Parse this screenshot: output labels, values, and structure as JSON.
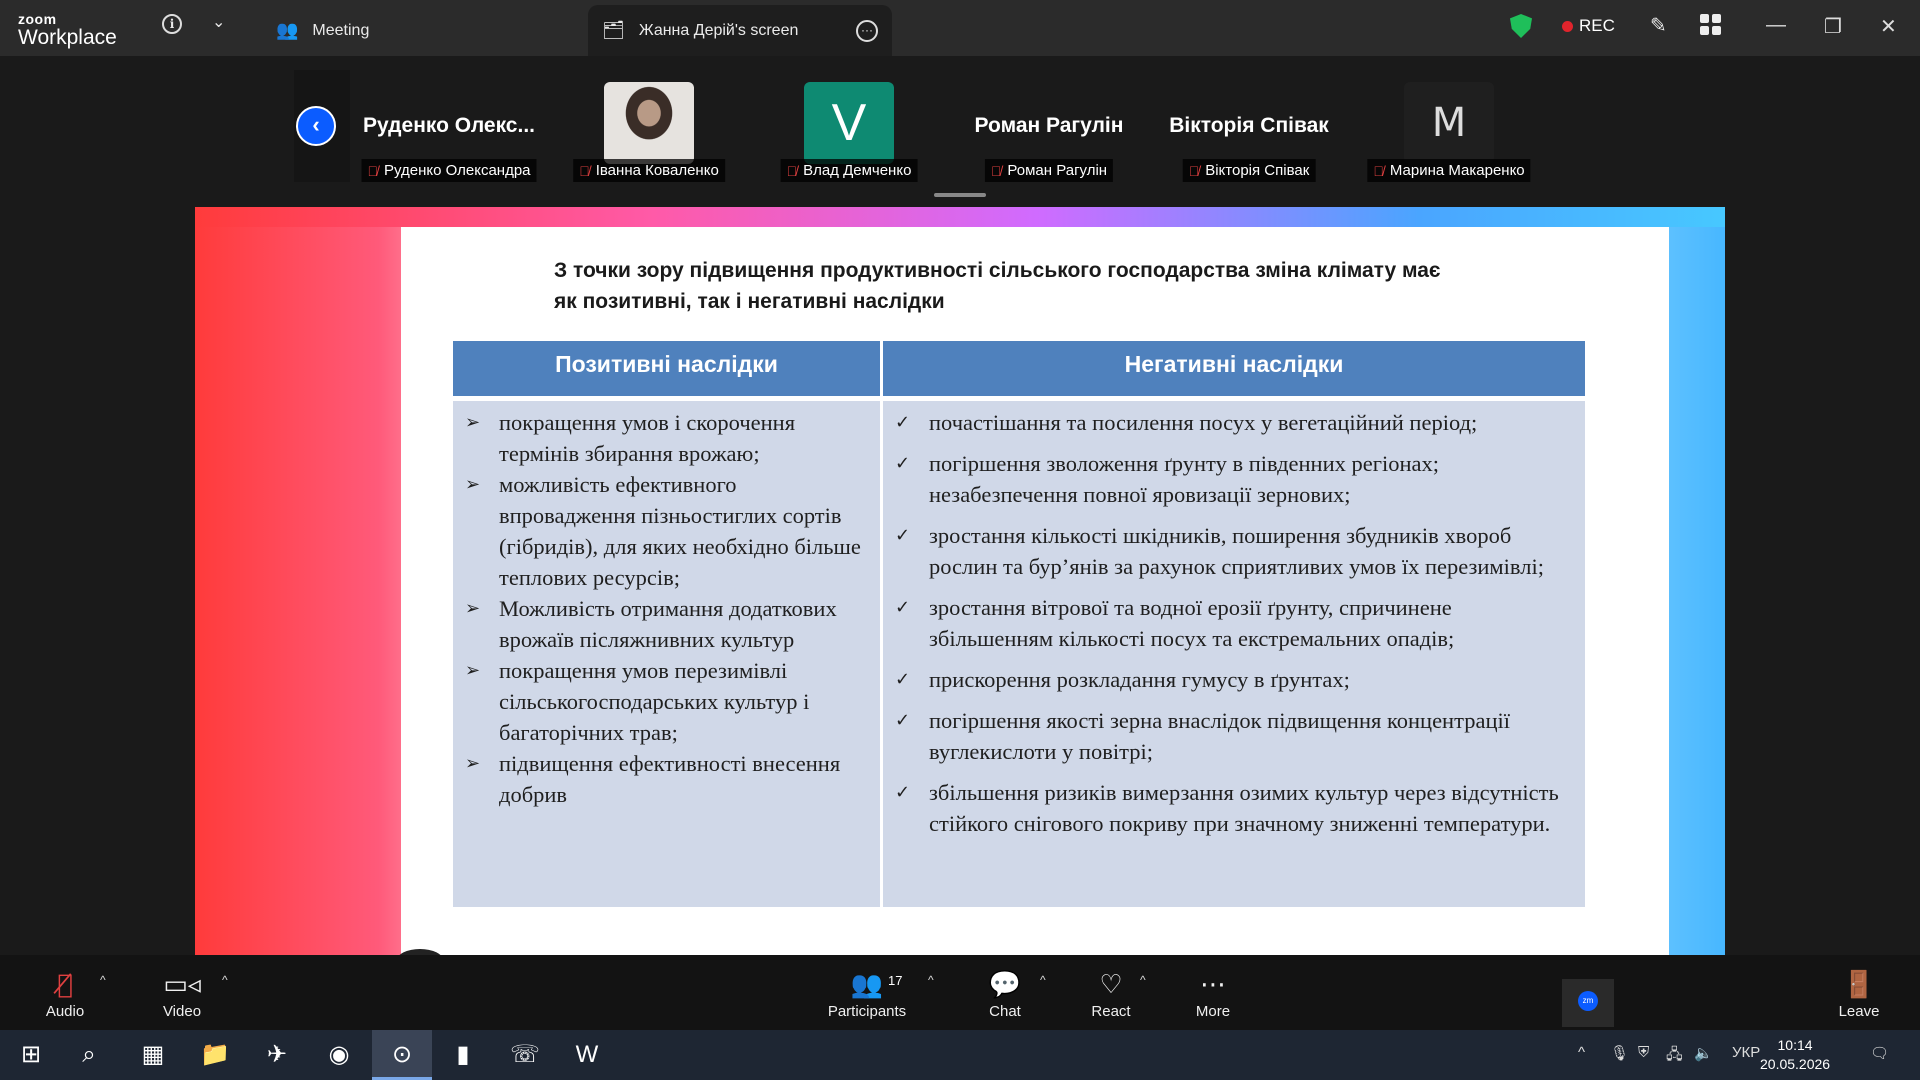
{
  "app": {
    "logo_small": "zoom",
    "logo_big": "Workplace"
  },
  "tabs": [
    {
      "label": "Meeting",
      "icon": "meeting-icon"
    },
    {
      "label": "Жанна Дерій's screen",
      "icon": "share-screen-icon"
    }
  ],
  "status": {
    "rec_label": "REC",
    "rec_color": "#e0242c",
    "shield_color": "#1fbf5a"
  },
  "participants": [
    {
      "display": "Руденко  Олекс...",
      "name": "Руденко Олександра",
      "avatar": "name"
    },
    {
      "display": "",
      "name": "Іванна Коваленко",
      "avatar": "photo"
    },
    {
      "display": "V",
      "name": "Влад Демченко",
      "avatar": "letter"
    },
    {
      "display": "Роман Рагулін",
      "name": "Роман Рагулін",
      "avatar": "name"
    },
    {
      "display": "Вікторія Співак",
      "name": "Вікторія Співак",
      "avatar": "name"
    },
    {
      "display": "M",
      "name": "Марина Макаренко",
      "avatar": "logo"
    }
  ],
  "slide": {
    "title_line1": "З точки зору підвищення продуктивності сільського господарства зміна клімату має",
    "title_line2": "як позитивні, так і негативні наслідки",
    "col1_header": "Позитивні наслідки",
    "col2_header": "Негативні наслідки",
    "positive": [
      "покращення умов і скорочення термінів збирання врожаю;",
      "можливість ефективного впровадження пізньостиглих сортів (гібридів), для яких необхідно більше теплових ресурсів;",
      "Можливість отримання додаткових врожаїв післяжнивних культур",
      "покращення умов перезимівлі сільськогосподарських культур і багаторічних трав;",
      " підвищення ефективності внесення добрив"
    ],
    "negative": [
      "почастішання та посилення посух у вегетаційний період;",
      "погіршення зволоження ґрунту в південних регіонах; незабезпечення повної яровизації зернових;",
      " зростання кількості шкідників, поширення збудників хвороб рослин та бур’янів за рахунок сприятливих умов їх перезимівлі;",
      "зростання вітрової та водної ерозії ґрунту, спричинене збільшенням кількості посух та екстремальних опадів;",
      "прискорення розкладання гумусу в ґрунтах;",
      "погіршення якості зерна внаслідок підвищення концентрації вуглекислоти у повітрі;",
      "збільшення ризиків вимерзання озимих культур через відсутність стійкого снігового покриву при значному зниженні температури."
    ]
  },
  "toolbar": {
    "audio": "Audio",
    "video": "Video",
    "participants": "Participants",
    "participants_count": "17",
    "chat": "Chat",
    "react": "React",
    "more": "More",
    "leave": "Leave"
  },
  "taskbar": {
    "language": "УКР",
    "time": "10:14",
    "date": "20.05.2026"
  }
}
